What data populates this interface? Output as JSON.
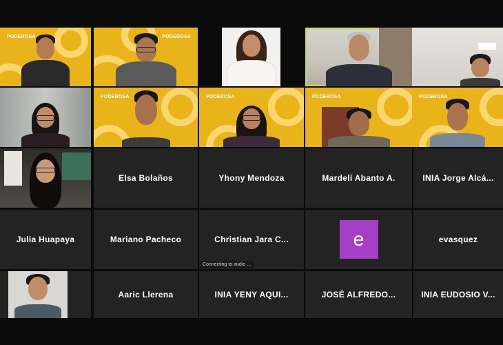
{
  "participants": {
    "brand_label": "PODEROSA",
    "row1": [
      "",
      "",
      "",
      "",
      ""
    ],
    "row3": [
      "Elsa Bolaños",
      "Yhony Mendoza",
      "Mardelí Abanto A.",
      "INIA Jorge Alcá..."
    ],
    "row4": [
      "Julia Huapaya",
      "Mariano Pacheco",
      "Christian Jara C...",
      "e",
      "evasquez"
    ],
    "row5": [
      "Aaric Llerena",
      "INIA YENY AQUI...",
      "JOSÉ ALFREDO...",
      "INIA EUDOSIO V..."
    ]
  },
  "status": {
    "connecting": "Connecting to audio ..."
  },
  "colors": {
    "brand_yellow": "#e9b31a",
    "active_border": "#c6dc4a",
    "avatar_purple": "#a540c6",
    "tile_bg": "#232323"
  },
  "icons": {
    "avatar_letter": "e"
  }
}
